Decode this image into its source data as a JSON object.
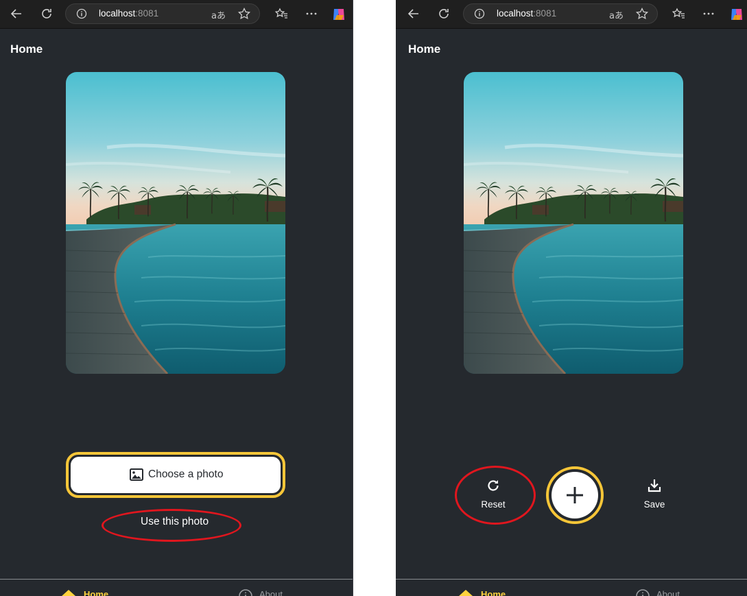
{
  "browser": {
    "url_host": "localhost",
    "url_port": ":8081",
    "read_aloud_label": "aあ"
  },
  "app": {
    "title": "Home",
    "choose_button_label": "Choose a photo",
    "use_photo_label": "Use this photo",
    "reset_label": "Reset",
    "save_label": "Save",
    "tabs": {
      "home": "Home",
      "about": "About"
    },
    "accent_color": "#ffd33d",
    "background_color": "#25292e",
    "annotation_color": "#e0161e"
  },
  "icons": {
    "back": "back-arrow-icon",
    "refresh": "refresh-icon",
    "site_info": "info-icon",
    "favorite": "star-icon",
    "favorites_list": "favorites-icon",
    "more": "more-icon",
    "copilot": "copilot-icon",
    "image": "image-icon",
    "reset": "refresh-icon",
    "add": "plus-icon",
    "save": "download-icon",
    "home": "home-icon",
    "about": "info-icon"
  }
}
